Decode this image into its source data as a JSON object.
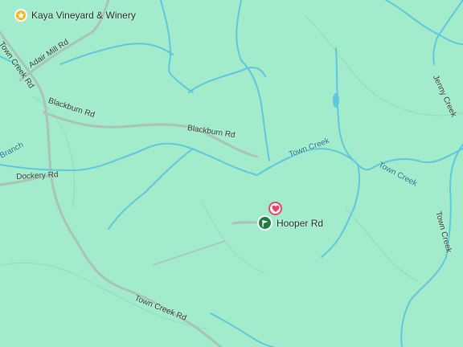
{
  "map": {
    "places": {
      "kaya": {
        "label": "Kaya Vineyard & Winery",
        "icon": "star-icon",
        "color": "#f2b619"
      },
      "hooper": {
        "label": "Hooper Rd",
        "icon": "trailhead-flag-icon",
        "color": "#1e7d3f"
      },
      "saved": {
        "icon": "heart-icon",
        "color": "#e8456b"
      }
    },
    "roads": {
      "adair_mill": "Adair Mill Rd",
      "town_creek_rd_north": "Town Creek Rd",
      "blackburn_west": "Blackburn Rd",
      "blackburn_east": "Blackburn Rd",
      "dockery": "Dockery Rd",
      "town_creek_rd_south": "Town Creek Rd",
      "jenny_creek": "Jenny Creek",
      "town_creek_vertical": "Town Creek"
    },
    "water": {
      "town_creek_center": "Town Creek",
      "town_creek_east": "Town Creek",
      "branch": "Branch"
    },
    "colors": {
      "land": "#a2eccc",
      "road": "#9fb8ad",
      "stream": "#5cc6dc",
      "contour": "#8ed8b6"
    }
  }
}
